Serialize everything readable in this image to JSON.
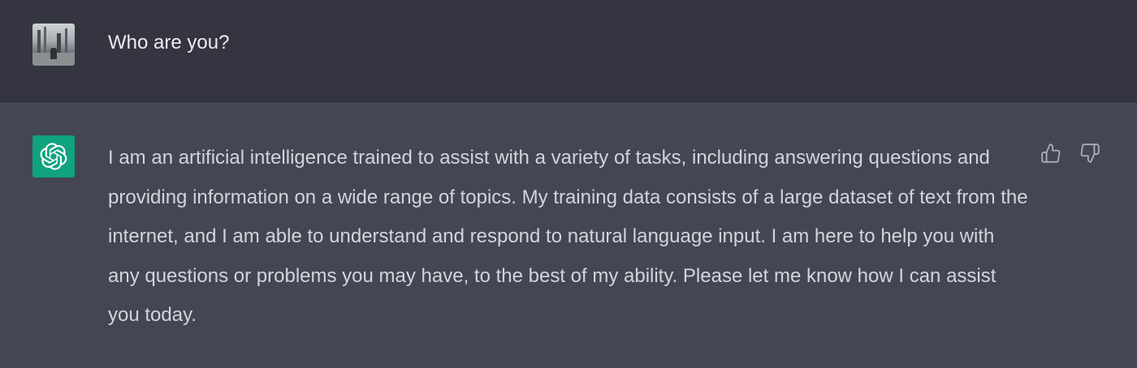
{
  "conversation": {
    "user_message": {
      "text": "Who are you?",
      "avatar": "user-photo"
    },
    "assistant_message": {
      "text": "I am an artificial intelligence trained to assist with a variety of tasks, including answering questions and providing information on a wide range of topics. My training data consists of a large dataset of text from the internet, and I am able to understand and respond to natural language input. I am here to help you with any questions or problems you may have, to the best of my ability. Please let me know how I can assist you today.",
      "avatar": "openai-logo-icon",
      "feedback": {
        "up_icon": "thumbs-up-icon",
        "down_icon": "thumbs-down-icon"
      }
    }
  },
  "colors": {
    "user_row_bg": "#343541",
    "assistant_row_bg": "#444654",
    "bot_avatar_bg": "#10a37f",
    "text_primary": "#ececf1",
    "text_secondary": "#d1d5db",
    "icon": "#acacbe"
  }
}
